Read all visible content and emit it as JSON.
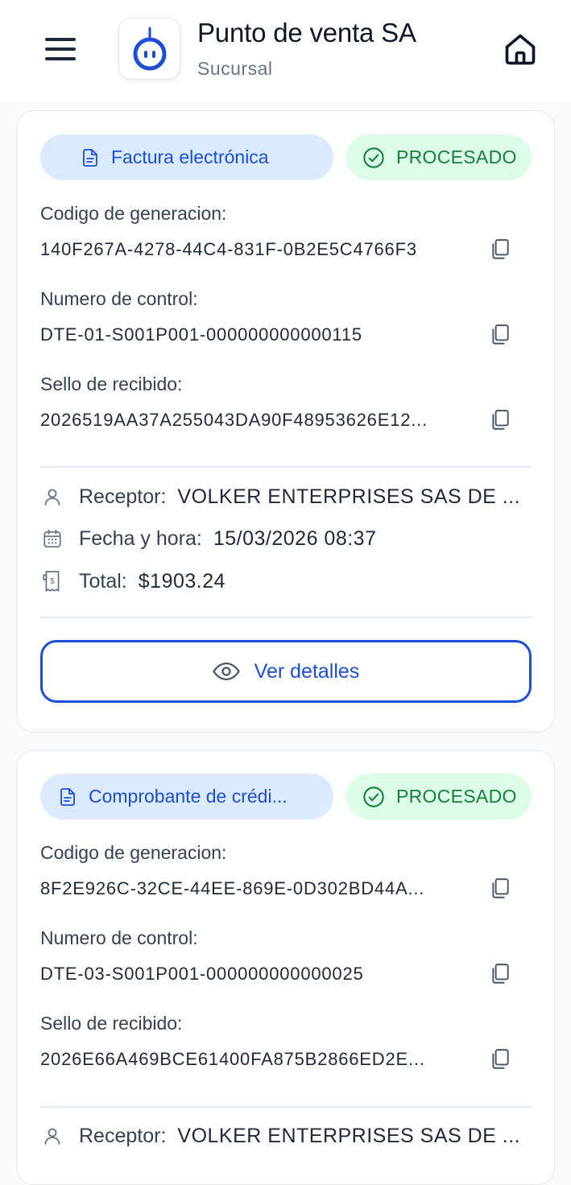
{
  "header": {
    "title": "Punto de venta SA",
    "subtitle": "Sucursal"
  },
  "fields": {
    "codigo_label": "Codigo de generacion:",
    "control_label": "Numero de control:",
    "sello_label": "Sello de recibido:",
    "receptor_label": "Receptor:",
    "fecha_label": "Fecha y hora:",
    "total_label": "Total:"
  },
  "cards": [
    {
      "type": "Factura electrónica",
      "status": "PROCESADO",
      "codigo": "140F267A-4278-44C4-831F-0B2E5C4766F3",
      "control": "DTE-01-S001P001-000000000000115",
      "sello": "2026519AA37A255043DA90F48953626E12...",
      "receptor": "VOLKER ENTERPRISES SAS DE ...",
      "fecha": "15/03/2026 08:37",
      "total": "$1903.24",
      "details_label": "Ver detalles"
    },
    {
      "type": "Comprobante de crédi...",
      "status": "PROCESADO",
      "codigo": "8F2E926C-32CE-44EE-869E-0D302BD44A...",
      "control": "DTE-03-S001P001-000000000000025",
      "sello": "2026E66A469BCE61400FA875B2866ED2E...",
      "receptor": "VOLKER ENTERPRISES SAS DE ..."
    }
  ],
  "colors": {
    "accent": "#1d4ed8",
    "type_pill_bg": "#dbeafe",
    "status_green": "#15803d",
    "status_bg": "#dcfce7"
  },
  "icons": [
    "menu-icon",
    "robot-logo-icon",
    "home-icon",
    "document-icon",
    "check-circle-icon",
    "copy-icon",
    "user-icon",
    "calendar-icon",
    "receipt-icon",
    "eye-icon"
  ]
}
